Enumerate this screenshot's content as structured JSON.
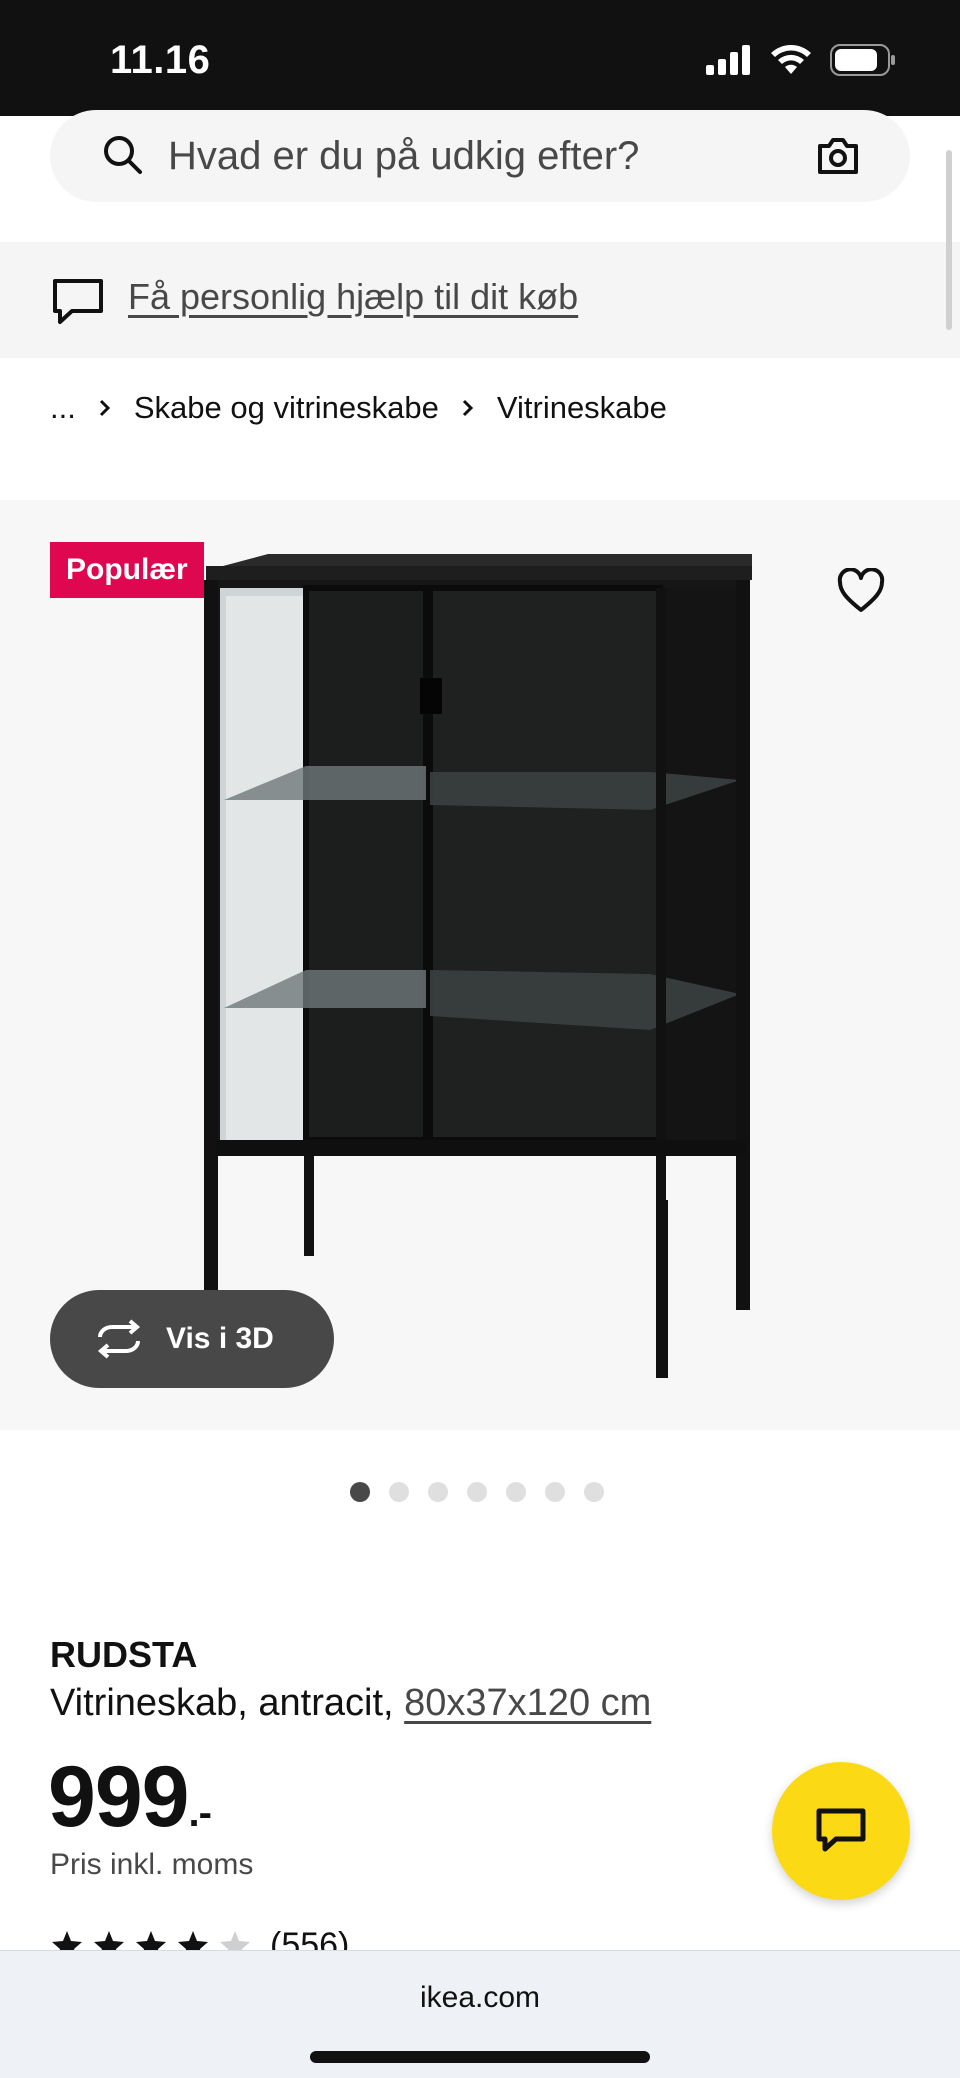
{
  "status_bar": {
    "time": "11.16"
  },
  "search": {
    "placeholder": "Hvad er du på udkig efter?"
  },
  "help": {
    "label": "Få personlig hjælp til dit køb"
  },
  "breadcrumb": {
    "items": [
      "...",
      "Skabe og vitrineskabe",
      "Vitrineskabe"
    ]
  },
  "image": {
    "badge": "Populær",
    "view_3d_label": "Vis i 3D",
    "pager_total": 7,
    "pager_active": 1
  },
  "product": {
    "name": "RUDSTA",
    "description": "Vitrineskab, antracit,",
    "dimensions": "80x37x120 cm",
    "price": "999",
    "price_suffix": ".-",
    "price_note": "Pris inkl. moms",
    "rating_value": 4.5,
    "rating_count": "(556)"
  },
  "browser": {
    "url": "ikea.com"
  },
  "colors": {
    "badge": "#e00751",
    "chat_fab": "#fbd914",
    "status_bar": "#111111",
    "view_3d": "#484848"
  }
}
